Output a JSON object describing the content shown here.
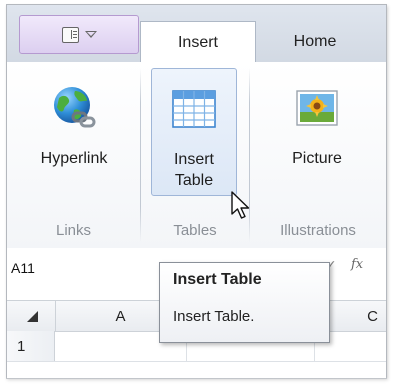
{
  "tabs": {
    "active": "Insert",
    "insert_label": "Insert",
    "home_label": "Home"
  },
  "app_menu": {
    "icon": "panel-layout-icon",
    "dropdown_icon": "chevron-down-icon"
  },
  "ribbon": {
    "groups": [
      {
        "label": "Links",
        "buttons": [
          {
            "label": "Hyperlink",
            "icon": "globe-link-icon"
          }
        ]
      },
      {
        "label": "Tables",
        "buttons": [
          {
            "label_line1": "Insert",
            "label_line2": "Table",
            "icon": "table-icon"
          }
        ]
      },
      {
        "label": "Illustrations",
        "buttons": [
          {
            "label": "Picture",
            "icon": "picture-icon"
          }
        ]
      }
    ]
  },
  "formula_bar": {
    "name_box": "A11",
    "check_symbol": "✓",
    "fx_label": "fx"
  },
  "grid": {
    "columns": [
      "A",
      "",
      "C"
    ],
    "rows": [
      "1"
    ]
  },
  "tooltip": {
    "title": "Insert Table",
    "body": "Insert Table."
  },
  "colors": {
    "active_tab_bg": "#ffffff",
    "tabstrip_bg": "#dfe5ee",
    "app_menu_bg": "#e6dbf4",
    "button_hover_border": "#9fb6d8",
    "group_label_color": "#8a8f96"
  }
}
